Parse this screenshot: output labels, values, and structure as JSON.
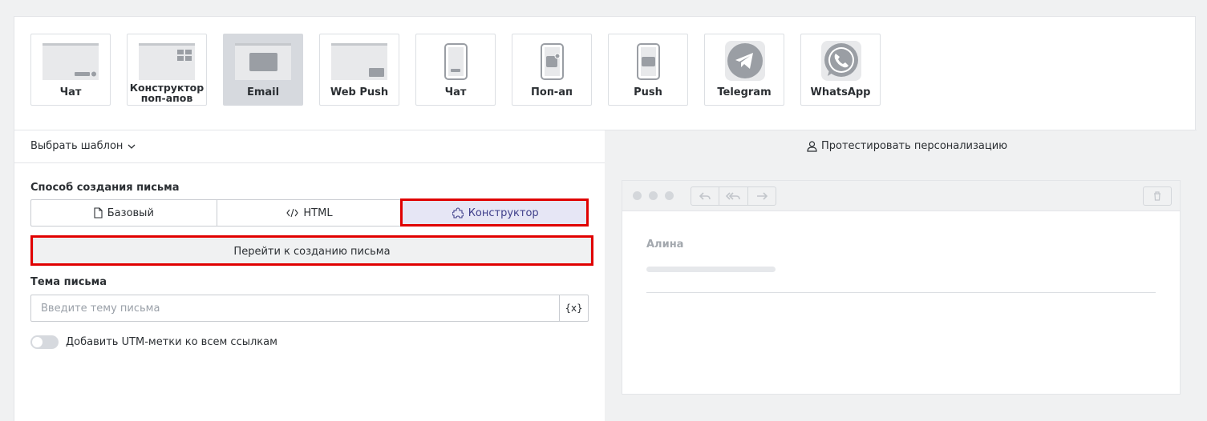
{
  "channels": [
    {
      "label": "Чат",
      "icon": "chat-desktop-icon",
      "selected": false
    },
    {
      "label": "Конструктор поп-апов",
      "icon": "popup-builder-icon",
      "selected": false
    },
    {
      "label": "Email",
      "icon": "email-icon",
      "selected": true
    },
    {
      "label": "Web Push",
      "icon": "web-push-icon",
      "selected": false
    },
    {
      "label": "Чат",
      "icon": "chat-mobile-icon",
      "selected": false
    },
    {
      "label": "Поп-ап",
      "icon": "popup-mobile-icon",
      "selected": false
    },
    {
      "label": "Push",
      "icon": "push-mobile-icon",
      "selected": false
    },
    {
      "label": "Telegram",
      "icon": "telegram-icon",
      "selected": false
    },
    {
      "label": "WhatsApp",
      "icon": "whatsapp-icon",
      "selected": false
    }
  ],
  "template_select": {
    "label": "Выбрать шаблон"
  },
  "test_personalization": {
    "label": "Протестировать персонализацию"
  },
  "creation_method": {
    "title": "Способ создания письма",
    "options": [
      {
        "label": "Базовый",
        "icon": "file-icon"
      },
      {
        "label": "HTML",
        "icon": "code-icon"
      },
      {
        "label": "Конструктор",
        "icon": "puzzle-icon",
        "active": true
      }
    ],
    "go_button": "Перейти к созданию письма"
  },
  "subject": {
    "title": "Тема письма",
    "placeholder": "Введите тему письма",
    "value": "",
    "var_button": "{x}"
  },
  "utm": {
    "label": "Добавить UTM-метки ко всем ссылкам",
    "enabled": false
  },
  "preview": {
    "sender": "Алина"
  },
  "colors": {
    "highlight": "#e00000",
    "active_segment": "#e6e6f5",
    "selected_tile": "#d6d9de"
  }
}
